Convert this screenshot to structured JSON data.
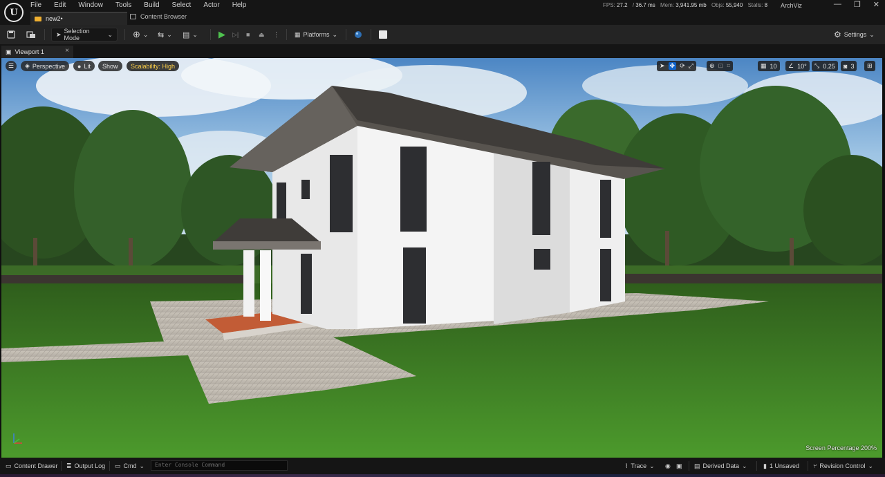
{
  "menu": {
    "items": [
      "File",
      "Edit",
      "Window",
      "Tools",
      "Build",
      "Select",
      "Actor",
      "Help"
    ]
  },
  "stats": {
    "fps_label": "FPS:",
    "fps": "27.2",
    "ms_sep": "/",
    "ms": "36.7 ms",
    "mem_label": "Mem:",
    "mem": "3,941.95 mb",
    "objs_label": "Objs:",
    "objs": "55,940",
    "stalls_label": "Stalls:",
    "stalls": "8"
  },
  "project_name": "ArchViz",
  "tabs": {
    "level": "new2•",
    "content_browser": "Content Browser"
  },
  "toolbar": {
    "selection_mode": "Selection Mode",
    "platforms": "Platforms",
    "settings": "Settings"
  },
  "viewport_tab": "Viewport 1",
  "viewport": {
    "perspective": "Perspective",
    "lit": "Lit",
    "show": "Show",
    "scalability": "Scalability: High",
    "grid_snap": "10",
    "rot_snap": "10°",
    "scale_snap": "0.25",
    "cam_speed": "3",
    "screen_percentage": "Screen Percentage  200%"
  },
  "bottom": {
    "content_drawer": "Content Drawer",
    "output_log": "Output Log",
    "cmd": "Cmd",
    "console_placeholder": "Enter Console Command",
    "trace": "Trace",
    "derived_data": "Derived Data",
    "unsaved": "1 Unsaved",
    "revision_control": "Revision Control"
  },
  "colors": {
    "accent_blue": "#0f62c8",
    "play_green": "#4fc24f",
    "scalability_yellow": "#ffd24a",
    "modified_folder": "#f0b030"
  }
}
